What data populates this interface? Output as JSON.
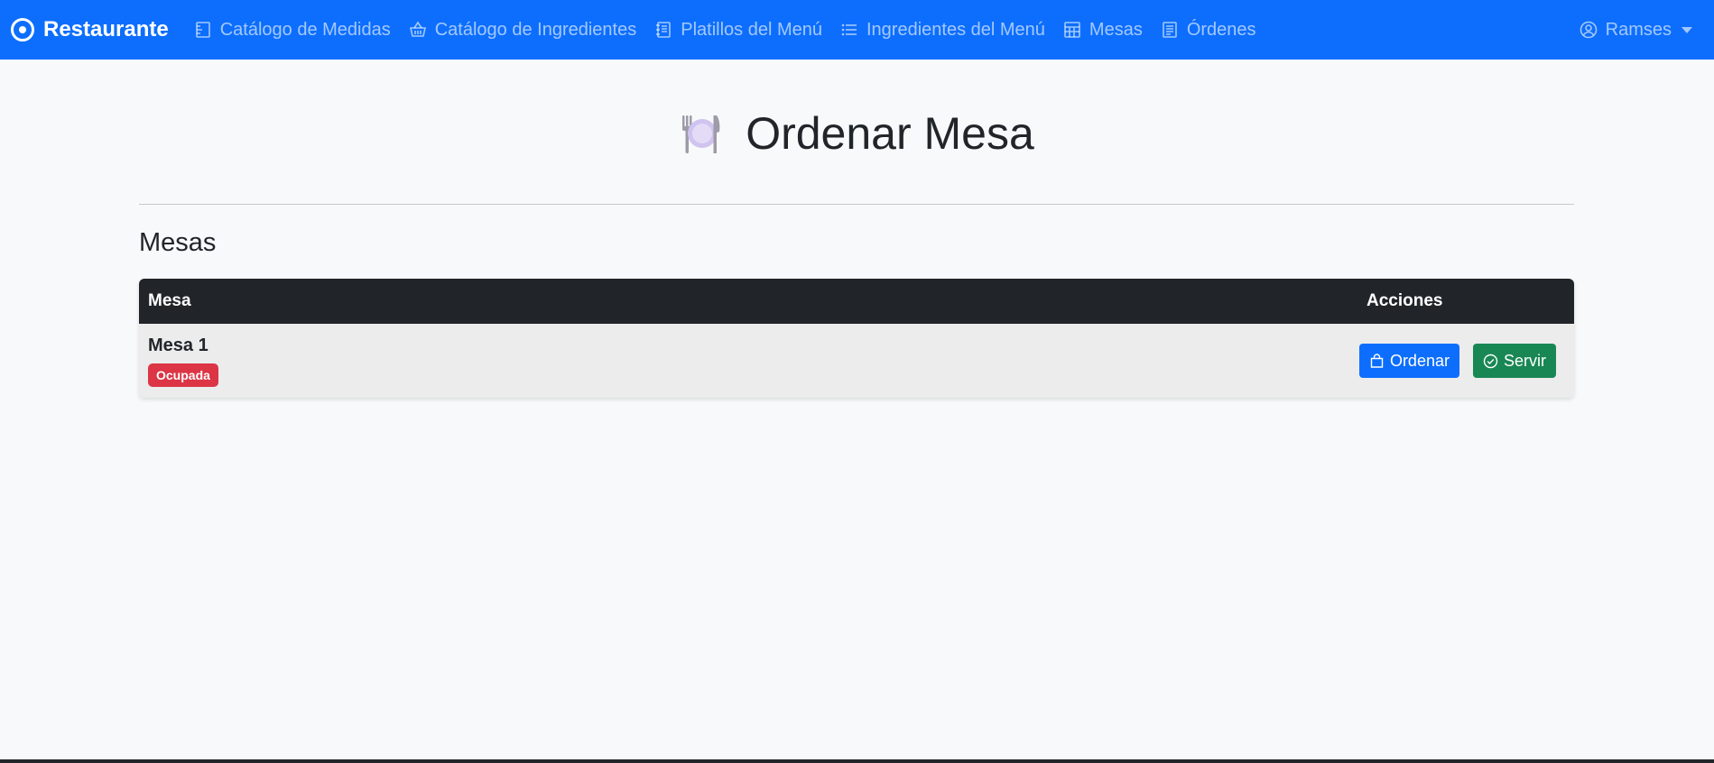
{
  "navbar": {
    "brand": "Restaurante",
    "items": [
      {
        "label": "Catálogo de Medidas",
        "icon": "ruler-icon"
      },
      {
        "label": "Catálogo de Ingredientes",
        "icon": "basket-icon"
      },
      {
        "label": "Platillos del Menú",
        "icon": "journal-icon"
      },
      {
        "label": "Ingredientes del Menú",
        "icon": "list-icon"
      },
      {
        "label": "Mesas",
        "icon": "table-icon"
      },
      {
        "label": "Órdenes",
        "icon": "receipt-icon"
      }
    ],
    "user": "Ramses"
  },
  "page": {
    "title": "Ordenar Mesa",
    "title_icon": "plate-cutlery-icon",
    "section_title": "Mesas"
  },
  "table": {
    "headers": {
      "mesa": "Mesa",
      "acciones": "Acciones"
    },
    "rows": [
      {
        "mesa": "Mesa 1",
        "status": "Ocupada",
        "actions": {
          "order": "Ordenar",
          "serve": "Servir"
        }
      }
    ]
  },
  "colors": {
    "navbar": "#0d6efd",
    "badge_danger": "#dc3545",
    "btn_primary": "#0d6efd",
    "btn_success": "#198754",
    "table_header": "#212529"
  }
}
